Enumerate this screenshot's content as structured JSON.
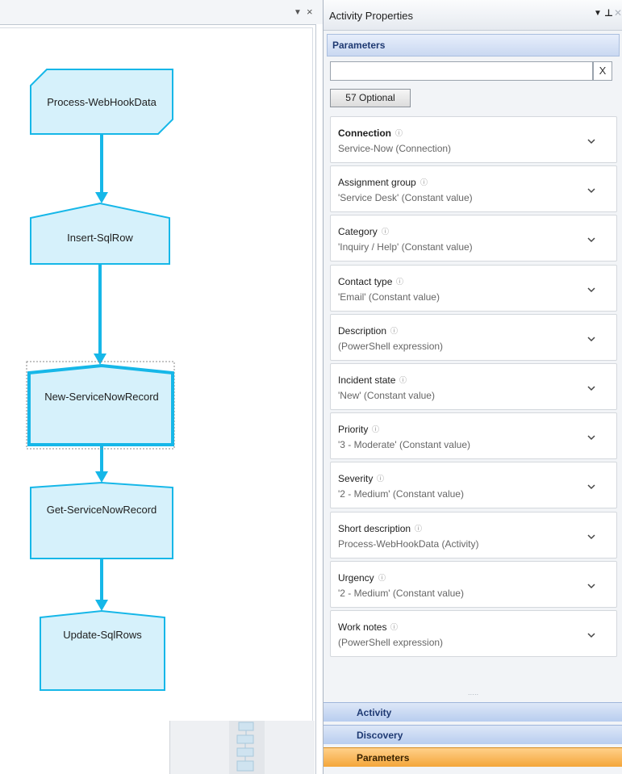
{
  "designer": {
    "close_glyph": "×",
    "dropdown_glyph": "▼",
    "nodes": [
      {
        "label": "Process-WebHookData"
      },
      {
        "label": "Insert-SqlRow"
      },
      {
        "label": "New-ServiceNowRecord",
        "selected": true
      },
      {
        "label": "Get-ServiceNowRecord"
      },
      {
        "label": "Update-SqlRows"
      }
    ]
  },
  "properties": {
    "title": "Activity Properties",
    "dropdown_glyph": "▼",
    "pin_glyph": "ꟸ",
    "close_glyph": "✕",
    "section_title": "Parameters",
    "search": {
      "value": "",
      "placeholder": "",
      "clear_label": "X"
    },
    "optional_button": "57 Optional",
    "info_glyph": "ⓘ",
    "params": [
      {
        "name": "Connection",
        "value": "Service-Now (Connection)",
        "bold": true
      },
      {
        "name": "Assignment group",
        "value": "'Service Desk' (Constant value)"
      },
      {
        "name": "Category",
        "value": "'Inquiry / Help' (Constant value)"
      },
      {
        "name": "Contact type",
        "value": "'Email' (Constant value)"
      },
      {
        "name": "Description",
        "value": "(PowerShell expression)"
      },
      {
        "name": "Incident state",
        "value": "'New' (Constant value)"
      },
      {
        "name": "Priority",
        "value": "'3 - Moderate' (Constant value)"
      },
      {
        "name": "Severity",
        "value": "'2 - Medium' (Constant value)"
      },
      {
        "name": "Short description",
        "value": "Process-WebHookData (Activity)"
      },
      {
        "name": "Urgency",
        "value": "'2 - Medium' (Constant value)"
      },
      {
        "name": "Work notes",
        "value": "(PowerShell expression)"
      }
    ],
    "splitter_glyph": "·····",
    "nav": [
      {
        "label": "Activity",
        "active": false
      },
      {
        "label": "Discovery",
        "active": false
      },
      {
        "label": "Parameters",
        "active": true
      }
    ]
  },
  "colors": {
    "node_fill": "#d6f1fb",
    "node_stroke": "#16b7e8",
    "connector": "#16b7e8",
    "nav_active": "#f6a93b",
    "section_header": "#c9d8f1"
  }
}
